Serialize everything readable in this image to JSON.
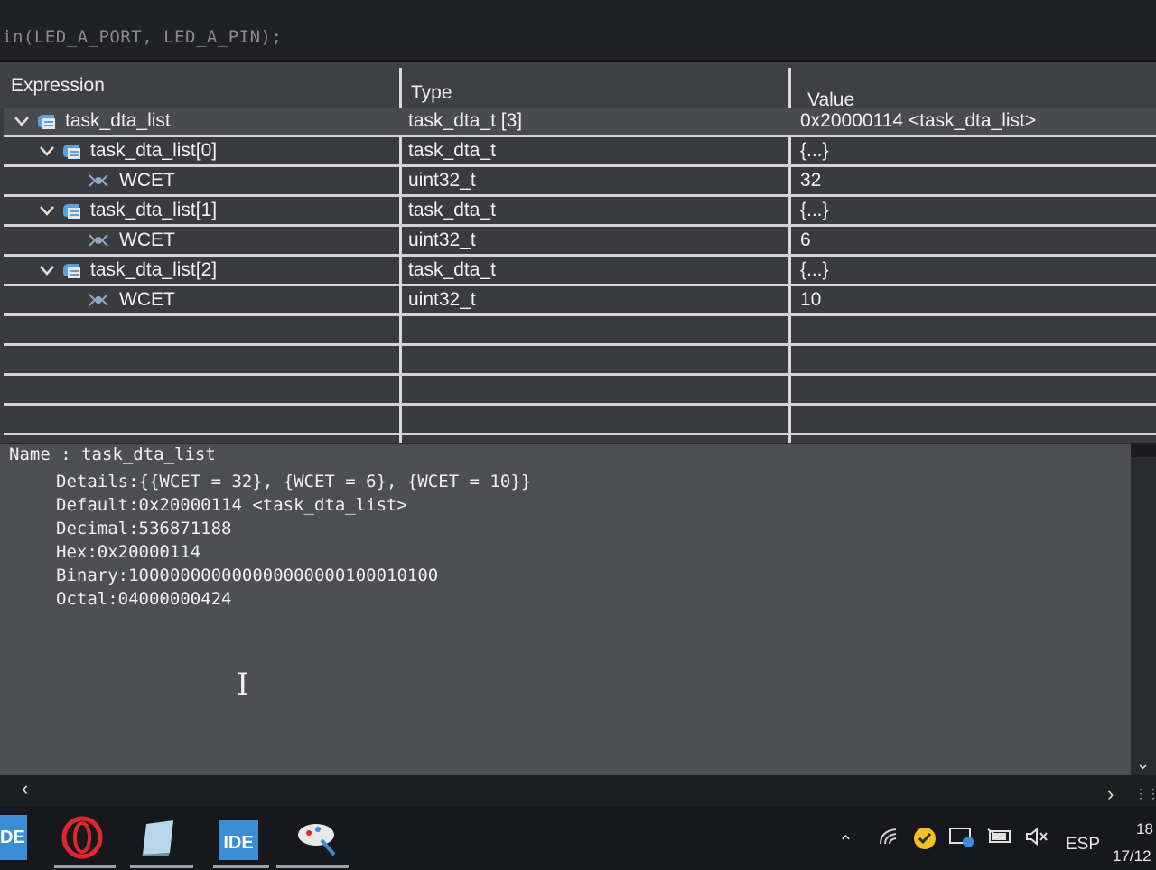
{
  "editor": {
    "code_line": "in(LED_A_PORT, LED_A_PIN);"
  },
  "expressions": {
    "columns": {
      "expression": "Expression",
      "type": "Type",
      "value": "Value"
    },
    "rows": [
      {
        "name": "task_dta_list",
        "type": "task_dta_t [3]",
        "value": "0x20000114 <task_dta_list>",
        "level": 0,
        "icon": "struct-icon"
      },
      {
        "name": "task_dta_list[0]",
        "type": "task_dta_t",
        "value": "{...}",
        "level": 1,
        "icon": "struct-icon"
      },
      {
        "name": "WCET",
        "type": "uint32_t",
        "value": "32",
        "level": 2,
        "icon": "variable-icon"
      },
      {
        "name": "task_dta_list[1]",
        "type": "task_dta_t",
        "value": "{...}",
        "level": 1,
        "icon": "struct-icon"
      },
      {
        "name": "WCET",
        "type": "uint32_t",
        "value": "6",
        "level": 2,
        "icon": "variable-icon"
      },
      {
        "name": "task_dta_list[2]",
        "type": "task_dta_t",
        "value": "{...}",
        "level": 1,
        "icon": "struct-icon"
      },
      {
        "name": "WCET",
        "type": "uint32_t",
        "value": "10",
        "level": 2,
        "icon": "variable-icon"
      }
    ]
  },
  "details": {
    "name_line": "Name : task_dta_list",
    "details_line": "Details:{{WCET = 32}, {WCET = 6}, {WCET = 10}}",
    "default_line": "Default:0x20000114 <task_dta_list>",
    "decimal_line": "Decimal:536871188",
    "hex_line": "Hex:0x20000114",
    "binary_line": "Binary:100000000000000000000100010100",
    "octal_line": "Octal:04000000424"
  },
  "taskbar": {
    "ide_left_label": "DE",
    "ide_label": "IDE",
    "language": "ESP",
    "time_partial": "18",
    "date_partial": "17/12"
  }
}
